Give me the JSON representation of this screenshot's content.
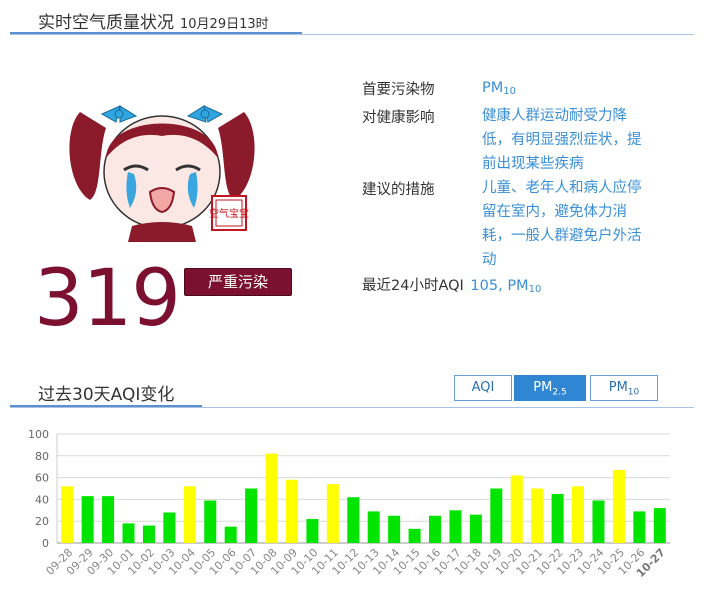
{
  "header": {
    "title": "实时空气质量状况",
    "timestamp": "10月29日13时"
  },
  "aqi": {
    "value": "319",
    "level": "严重污染",
    "stamp": "空气宝宝"
  },
  "info": {
    "primary_label": "首要污染物",
    "primary_value_main": "PM",
    "primary_value_sub": "10",
    "health_label": "对健康影响",
    "health_value": "健康人群运动耐受力降低，有明显强烈症状，提前出现某些疾病",
    "advice_label": "建议的措施",
    "advice_value": "儿童、老年人和病人应停留在室内，避免体力消耗，一般人群避免户外活动",
    "recent_label": "最近24小时AQI",
    "recent_value_main": "105, PM",
    "recent_value_sub": "10"
  },
  "section": {
    "title": "过去30天AQI变化"
  },
  "tabs": [
    {
      "main": "AQI",
      "sub": "",
      "active": false
    },
    {
      "main": "PM",
      "sub": "2.5",
      "active": true
    },
    {
      "main": "PM",
      "sub": "10",
      "active": false
    }
  ],
  "colors": {
    "accent": "#3a8fd6",
    "severe": "#7b1030",
    "bar_green": "#00e400",
    "bar_yellow": "#ffff00"
  },
  "chart_data": {
    "type": "bar",
    "ylim": [
      0,
      100
    ],
    "yticks": [
      0,
      20,
      40,
      60,
      80,
      100
    ],
    "grid": true,
    "categories": [
      "09-28",
      "09-29",
      "09-30",
      "10-01",
      "10-02",
      "10-03",
      "10-04",
      "10-05",
      "10-06",
      "10-07",
      "10-08",
      "10-09",
      "10-10",
      "10-11",
      "10-12",
      "10-13",
      "10-14",
      "10-15",
      "10-16",
      "10-17",
      "10-18",
      "10-19",
      "10-20",
      "10-21",
      "10-22",
      "10-23",
      "10-24",
      "10-25",
      "10-26",
      "10-27"
    ],
    "values": [
      52,
      43,
      43,
      18,
      16,
      28,
      52,
      39,
      15,
      50,
      82,
      58,
      22,
      54,
      42,
      29,
      25,
      13,
      25,
      30,
      26,
      50,
      62,
      50,
      45,
      52,
      39,
      67,
      29,
      32
    ],
    "bar_colors": [
      "#ffff00",
      "#00e400",
      "#00e400",
      "#00e400",
      "#00e400",
      "#00e400",
      "#ffff00",
      "#00e400",
      "#00e400",
      "#00e400",
      "#ffff00",
      "#ffff00",
      "#00e400",
      "#ffff00",
      "#00e400",
      "#00e400",
      "#00e400",
      "#00e400",
      "#00e400",
      "#00e400",
      "#00e400",
      "#00e400",
      "#ffff00",
      "#ffff00",
      "#00e400",
      "#ffff00",
      "#00e400",
      "#ffff00",
      "#00e400",
      "#00e400"
    ],
    "highlight_last_label": true
  }
}
